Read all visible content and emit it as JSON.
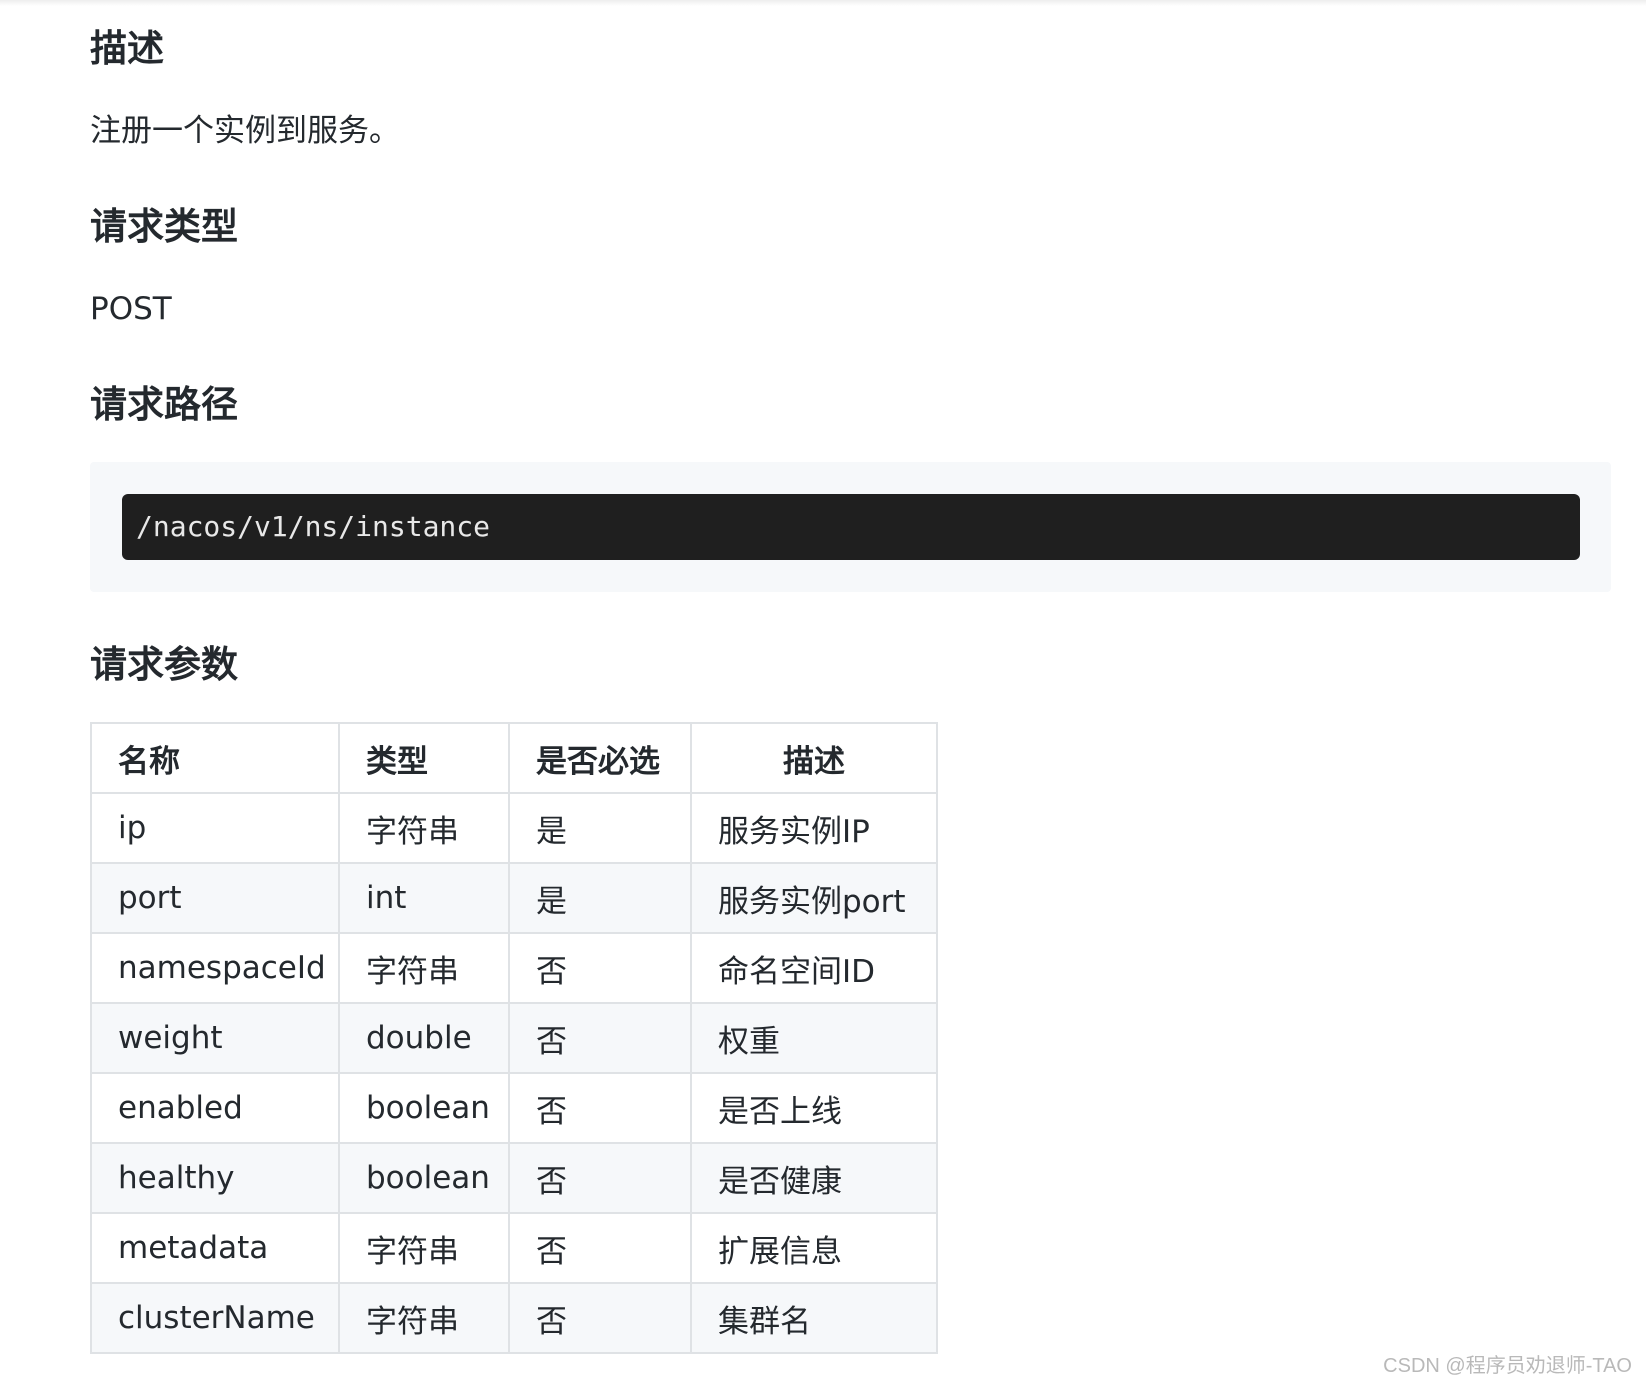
{
  "sections": {
    "description": {
      "heading": "描述",
      "text": "注册一个实例到服务。"
    },
    "request_type": {
      "heading": "请求类型",
      "text": "POST"
    },
    "request_path": {
      "heading": "请求路径",
      "code": "/nacos/v1/ns/instance"
    },
    "request_params": {
      "heading": "请求参数",
      "headers": [
        "名称",
        "类型",
        "是否必选",
        "描述"
      ],
      "rows": [
        [
          "ip",
          "字符串",
          "是",
          "服务实例IP"
        ],
        [
          "port",
          "int",
          "是",
          "服务实例port"
        ],
        [
          "namespaceId",
          "字符串",
          "否",
          "命名空间ID"
        ],
        [
          "weight",
          "double",
          "否",
          "权重"
        ],
        [
          "enabled",
          "boolean",
          "否",
          "是否上线"
        ],
        [
          "healthy",
          "boolean",
          "否",
          "是否健康"
        ],
        [
          "metadata",
          "字符串",
          "否",
          "扩展信息"
        ],
        [
          "clusterName",
          "字符串",
          "否",
          "集群名"
        ]
      ]
    }
  },
  "watermark": "CSDN @程序员劝退师-TAO"
}
